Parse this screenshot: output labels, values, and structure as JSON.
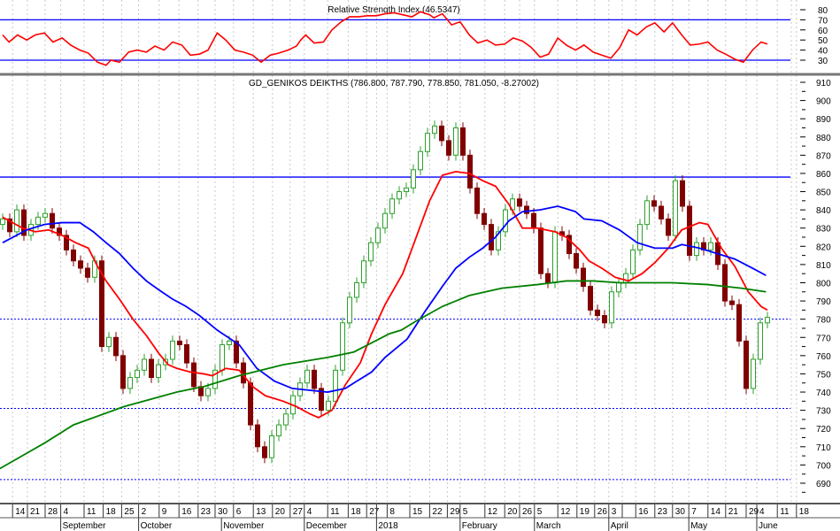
{
  "chart_data": [
    {
      "type": "line",
      "panel": "rsi",
      "title": "Relative Strength Index (46.5347)",
      "ylim": [
        20,
        85
      ],
      "yticks": [
        30,
        40,
        50,
        60,
        70,
        80
      ],
      "reference_lines": [
        70,
        30
      ],
      "color": "#ff0000",
      "ref_color": "#0000ff",
      "points": [
        [
          0,
          55
        ],
        [
          0.9,
          48
        ],
        [
          2.1,
          55
        ],
        [
          3.4,
          50
        ],
        [
          4.6,
          55
        ],
        [
          5.9,
          57
        ],
        [
          7.1,
          48
        ],
        [
          8.4,
          52
        ],
        [
          9.6,
          45
        ],
        [
          10.9,
          40
        ],
        [
          12.1,
          37
        ],
        [
          13.4,
          28
        ],
        [
          14.6,
          25
        ],
        [
          15.3,
          30
        ],
        [
          16.5,
          28
        ],
        [
          17.8,
          38
        ],
        [
          19,
          40
        ],
        [
          20.3,
          38
        ],
        [
          21.5,
          44
        ],
        [
          22.8,
          40
        ],
        [
          24,
          48
        ],
        [
          25.3,
          45
        ],
        [
          26.5,
          35
        ],
        [
          27.8,
          36
        ],
        [
          29,
          40
        ],
        [
          30.3,
          57
        ],
        [
          31.5,
          50
        ],
        [
          32.8,
          40
        ],
        [
          34,
          38
        ],
        [
          35.3,
          35
        ],
        [
          36.5,
          28
        ],
        [
          37.8,
          35
        ],
        [
          39,
          37
        ],
        [
          40.3,
          40
        ],
        [
          41.5,
          44
        ],
        [
          42.1,
          50
        ],
        [
          42.8,
          55
        ],
        [
          44,
          47
        ],
        [
          45.3,
          48
        ],
        [
          46.5,
          60
        ],
        [
          47.8,
          68
        ],
        [
          49,
          73
        ],
        [
          50.3,
          73
        ],
        [
          51.5,
          74
        ],
        [
          52.8,
          74
        ],
        [
          54,
          76
        ],
        [
          55.3,
          77
        ],
        [
          56.5,
          75
        ],
        [
          57.8,
          73
        ],
        [
          59,
          78
        ],
        [
          60.3,
          75
        ],
        [
          60.9,
          72
        ],
        [
          62.1,
          76
        ],
        [
          63.4,
          65
        ],
        [
          64.6,
          68
        ],
        [
          65.9,
          55
        ],
        [
          67.1,
          47
        ],
        [
          68.4,
          50
        ],
        [
          69.6,
          45
        ],
        [
          70.9,
          46
        ],
        [
          72.1,
          52
        ],
        [
          73.4,
          49
        ],
        [
          74.6,
          43
        ],
        [
          75.9,
          33
        ],
        [
          77.1,
          36
        ],
        [
          78.4,
          52
        ],
        [
          79.6,
          45
        ],
        [
          80.9,
          40
        ],
        [
          82.1,
          45
        ],
        [
          83.4,
          38
        ],
        [
          84.6,
          35
        ],
        [
          85.9,
          32
        ],
        [
          87.1,
          42
        ],
        [
          88.4,
          60
        ],
        [
          89.6,
          55
        ],
        [
          90.9,
          63
        ],
        [
          92.1,
          67
        ],
        [
          93.4,
          58
        ],
        [
          94.6,
          67
        ],
        [
          95.9,
          55
        ],
        [
          97.1,
          45
        ],
        [
          98.4,
          46
        ],
        [
          99.6,
          48
        ],
        [
          100.9,
          40
        ],
        [
          102.1,
          36
        ],
        [
          103.4,
          31
        ],
        [
          104.6,
          28
        ],
        [
          105.9,
          40
        ],
        [
          107.1,
          48
        ],
        [
          108,
          46
        ]
      ]
    },
    {
      "type": "candlestick",
      "panel": "price",
      "title": "GD_GENIKOS DEIKTHS (786.800, 787.790, 778.850, 781.050, -8.27002)",
      "ylim": [
        680,
        915
      ],
      "yticks": [
        690,
        700,
        710,
        720,
        730,
        740,
        750,
        760,
        770,
        780,
        790,
        800,
        810,
        820,
        830,
        840,
        850,
        860,
        870,
        880,
        890,
        900,
        910
      ],
      "up_color": "#2ca02c",
      "down_color": "#800000",
      "first_open": 832,
      "closes": [
        835,
        828,
        840,
        826,
        832,
        836,
        838,
        830,
        826,
        818,
        812,
        808,
        803,
        812,
        765,
        770,
        760,
        742,
        748,
        752,
        758,
        748,
        755,
        758,
        768,
        766,
        756,
        743,
        738,
        742,
        752,
        766,
        768,
        756,
        745,
        722,
        710,
        704,
        716,
        722,
        728,
        738,
        745,
        752,
        742,
        730,
        735,
        752,
        778,
        792,
        800,
        812,
        822,
        830,
        838,
        846,
        850,
        852,
        862,
        872,
        882,
        886,
        878,
        870,
        885,
        870,
        852,
        838,
        832,
        818,
        828,
        840,
        846,
        842,
        838,
        830,
        805,
        800,
        828,
        826,
        816,
        808,
        798,
        785,
        782,
        778,
        795,
        800,
        805,
        818,
        832,
        845,
        842,
        835,
        826,
        856,
        842,
        815,
        822,
        818,
        822,
        810,
        790,
        788,
        768,
        742,
        758,
        778,
        781
      ],
      "solid_lines": [
        {
          "value": 858,
          "color": "#0000ff"
        }
      ],
      "dotted_lines": [
        {
          "value": 780,
          "color": "#0000ff"
        },
        {
          "value": 731,
          "color": "#0000ff"
        },
        {
          "value": 692,
          "color": "#0000ff"
        }
      ],
      "moving_averages": [
        {
          "name": "short MA",
          "color": "#ff0000",
          "points": [
            [
              0,
              836
            ],
            [
              2.8,
              830
            ],
            [
              4.6,
              828
            ],
            [
              6.5,
              829
            ],
            [
              8.4,
              826
            ],
            [
              10.3,
              822
            ],
            [
              12.1,
              819
            ],
            [
              13.4,
              809
            ],
            [
              14.6,
              801
            ],
            [
              16.5,
              791
            ],
            [
              18.4,
              780
            ],
            [
              20.3,
              771
            ],
            [
              22.1,
              761
            ],
            [
              23.4,
              755
            ],
            [
              24.6,
              753
            ],
            [
              26.5,
              751
            ],
            [
              28.4,
              750
            ],
            [
              29.6,
              749
            ],
            [
              31.5,
              753
            ],
            [
              33.4,
              752
            ],
            [
              35.3,
              743
            ],
            [
              37.1,
              738
            ],
            [
              39.6,
              735
            ],
            [
              41.5,
              732
            ],
            [
              43.4,
              728
            ],
            [
              44.6,
              726
            ],
            [
              46.5,
              730
            ],
            [
              48.4,
              744
            ],
            [
              50.5,
              756
            ],
            [
              52.1,
              772
            ],
            [
              54,
              788
            ],
            [
              56.5,
              805
            ],
            [
              58.4,
              825
            ],
            [
              60.3,
              845
            ],
            [
              62.1,
              859
            ],
            [
              64,
              861
            ],
            [
              65.9,
              860
            ],
            [
              67.8,
              856
            ],
            [
              69.6,
              853
            ],
            [
              71.5,
              843
            ],
            [
              73.4,
              830
            ],
            [
              75.5,
              830
            ],
            [
              78,
              828
            ],
            [
              79.6,
              825
            ],
            [
              81.5,
              818
            ],
            [
              82.8,
              812
            ],
            [
              84.6,
              808
            ],
            [
              86.5,
              803
            ],
            [
              88.4,
              801
            ],
            [
              90.3,
              805
            ],
            [
              92.1,
              811
            ],
            [
              94,
              819
            ],
            [
              95.9,
              829
            ],
            [
              98.4,
              833
            ],
            [
              99.6,
              832
            ],
            [
              101.5,
              819
            ],
            [
              103.4,
              809
            ],
            [
              105.3,
              795
            ],
            [
              107.1,
              787
            ],
            [
              108,
              785
            ]
          ]
        },
        {
          "name": "medium MA",
          "color": "#0000ff",
          "points": [
            [
              0,
              822
            ],
            [
              3.4,
              829
            ],
            [
              5.9,
              832
            ],
            [
              8.4,
              833
            ],
            [
              10.9,
              833
            ],
            [
              12.8,
              828
            ],
            [
              14.6,
              822
            ],
            [
              16.5,
              816
            ],
            [
              18.4,
              808
            ],
            [
              20.3,
              801
            ],
            [
              22.1,
              796
            ],
            [
              24,
              791
            ],
            [
              25.9,
              787
            ],
            [
              27.8,
              782
            ],
            [
              30.3,
              774
            ],
            [
              33.4,
              766
            ],
            [
              35.9,
              753
            ],
            [
              38.4,
              746
            ],
            [
              40.9,
              742
            ],
            [
              43.4,
              741
            ],
            [
              45.9,
              740
            ],
            [
              48.4,
              742
            ],
            [
              49.6,
              745
            ],
            [
              52.1,
              751
            ],
            [
              54,
              759
            ],
            [
              57.1,
              769
            ],
            [
              59.6,
              784
            ],
            [
              62.1,
              798
            ],
            [
              64,
              808
            ],
            [
              65.9,
              814
            ],
            [
              67.8,
              819
            ],
            [
              69.6,
              825
            ],
            [
              71.5,
              834
            ],
            [
              73.4,
              839
            ],
            [
              75.9,
              840
            ],
            [
              78.4,
              842
            ],
            [
              80.9,
              839
            ],
            [
              82.1,
              835
            ],
            [
              84.6,
              834
            ],
            [
              87.1,
              829
            ],
            [
              89.6,
              822
            ],
            [
              92.1,
              819
            ],
            [
              94.6,
              819
            ],
            [
              95.9,
              821
            ],
            [
              98.4,
              819
            ],
            [
              100.9,
              816
            ],
            [
              103.4,
              813
            ],
            [
              105.9,
              808
            ],
            [
              107.8,
              804
            ]
          ]
        },
        {
          "name": "long MA",
          "color": "#008000",
          "points": [
            [
              -0.4,
              698
            ],
            [
              5.9,
              712
            ],
            [
              10,
              722
            ],
            [
              17.1,
              732
            ],
            [
              24.6,
              740
            ],
            [
              27.1,
              742
            ],
            [
              28.4,
              743
            ],
            [
              33.4,
              749
            ],
            [
              39.6,
              755
            ],
            [
              45.9,
              759
            ],
            [
              49.6,
              762
            ],
            [
              54.6,
              772
            ],
            [
              56.3,
              774
            ],
            [
              58.4,
              779
            ],
            [
              62.1,
              787
            ],
            [
              65.9,
              793
            ],
            [
              70.5,
              797
            ],
            [
              75.5,
              799
            ],
            [
              79.6,
              801
            ],
            [
              83.4,
              801
            ],
            [
              87.1,
              800
            ],
            [
              94.6,
              800
            ],
            [
              99.6,
              799
            ],
            [
              104.3,
              797
            ],
            [
              107.8,
              795
            ]
          ]
        }
      ]
    }
  ],
  "x_axis": {
    "day_ticks": [
      {
        "label": "14",
        "i": 1.4
      },
      {
        "label": "21",
        "i": 3.5
      },
      {
        "label": "28",
        "i": 6
      },
      {
        "label": "4",
        "i": 8.2
      },
      {
        "label": "11",
        "i": 11.5
      },
      {
        "label": "18",
        "i": 14.2
      },
      {
        "label": "25",
        "i": 16.8
      },
      {
        "label": "2",
        "i": 19.2
      },
      {
        "label": "9",
        "i": 22.1
      },
      {
        "label": "16",
        "i": 24.9
      },
      {
        "label": "23",
        "i": 27.6
      },
      {
        "label": "30",
        "i": 30
      },
      {
        "label": "6",
        "i": 32.6
      },
      {
        "label": "13",
        "i": 35.4
      },
      {
        "label": "20",
        "i": 38.1
      },
      {
        "label": "27",
        "i": 40.6
      },
      {
        "label": "4",
        "i": 42.6
      },
      {
        "label": "11",
        "i": 45.9
      },
      {
        "label": "18",
        "i": 48.8
      },
      {
        "label": "27",
        "i": 51.4
      },
      {
        "label": "",
        "i": 52.8
      },
      {
        "label": "8",
        "i": 54.3
      },
      {
        "label": "15",
        "i": 57.5
      },
      {
        "label": "22",
        "i": 60.3
      },
      {
        "label": "29",
        "i": 62.8
      },
      {
        "label": "5",
        "i": 64.6
      },
      {
        "label": "12",
        "i": 68.1
      },
      {
        "label": "20",
        "i": 70.9
      },
      {
        "label": "26",
        "i": 73
      },
      {
        "label": "5",
        "i": 75.1
      },
      {
        "label": "12",
        "i": 78.4
      },
      {
        "label": "19",
        "i": 81.1
      },
      {
        "label": "26",
        "i": 83.6
      },
      {
        "label": "3",
        "i": 85.6
      },
      {
        "label": "",
        "i": 87.5
      },
      {
        "label": "16",
        "i": 89.4
      },
      {
        "label": "23",
        "i": 92.1
      },
      {
        "label": "30",
        "i": 94.6
      },
      {
        "label": "7",
        "i": 96.9
      },
      {
        "label": "14",
        "i": 99.6
      },
      {
        "label": "21",
        "i": 102.1
      },
      {
        "label": "29",
        "i": 105
      },
      {
        "label": "4",
        "i": 106.5
      },
      {
        "label": "11",
        "i": 109.4
      },
      {
        "label": "18",
        "i": 112.1
      }
    ],
    "months": [
      {
        "label": "September",
        "i": 8.2
      },
      {
        "label": "October",
        "i": 19.2
      },
      {
        "label": "November",
        "i": 30.9
      },
      {
        "label": "December",
        "i": 42.6
      },
      {
        "label": "2018",
        "i": 52.8
      },
      {
        "label": "February",
        "i": 64.6
      },
      {
        "label": "March",
        "i": 75.1
      },
      {
        "label": "April",
        "i": 85.6
      },
      {
        "label": "May",
        "i": 96.9
      },
      {
        "label": "June",
        "i": 106.5
      }
    ]
  }
}
